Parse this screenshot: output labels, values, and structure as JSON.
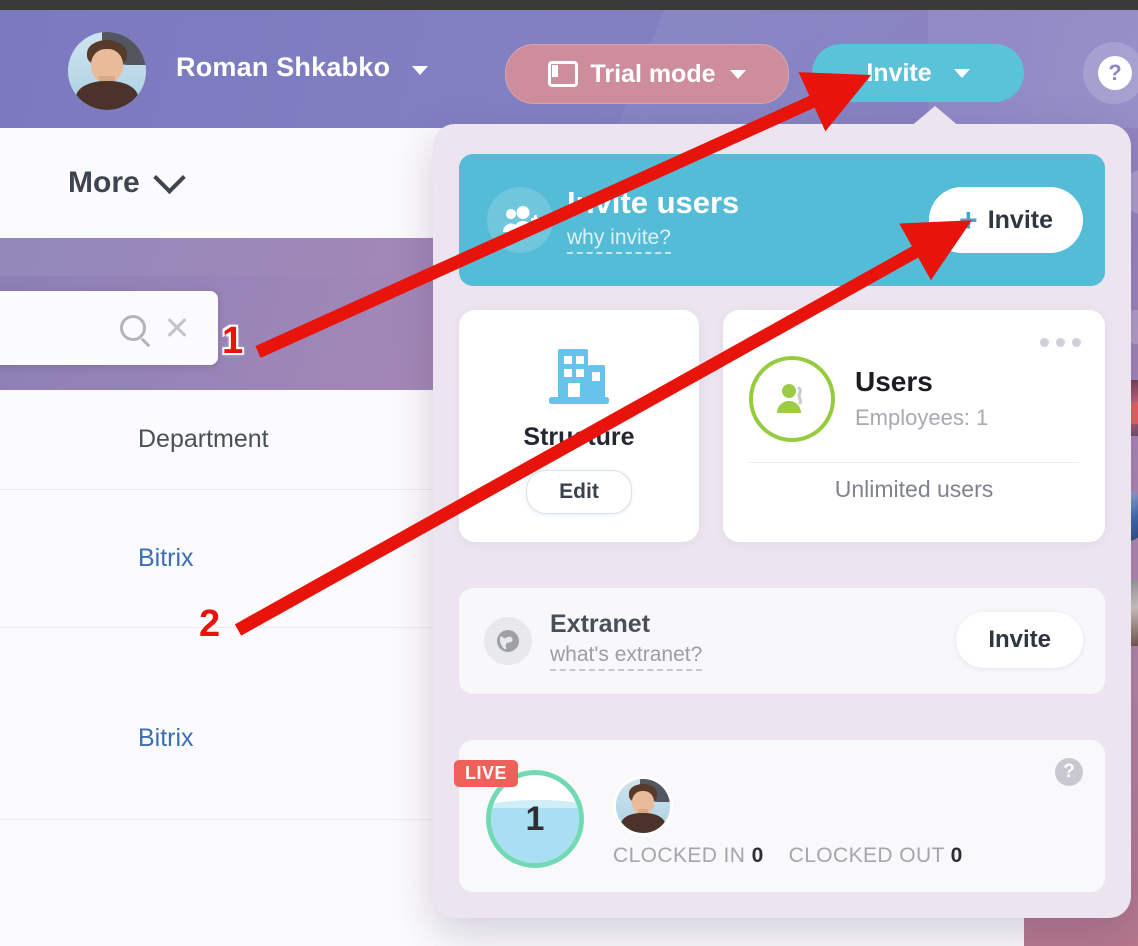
{
  "header": {
    "user_name": "Roman Shkabko",
    "name_caret": "chevron-down-icon",
    "trial_label": "Trial mode",
    "invite_label": "Invite",
    "help_label": "?"
  },
  "background": {
    "more_label": "More",
    "search_placeholder": "",
    "search_value": "",
    "column_header": "Department",
    "rows": [
      {
        "label": "Bitrix"
      },
      {
        "label": "Bitrix"
      }
    ]
  },
  "popup": {
    "banner": {
      "title": "Invite users",
      "link": "why invite?",
      "button_plus": "+",
      "button_label": "Invite"
    },
    "structure_card": {
      "title": "Structure",
      "edit_label": "Edit"
    },
    "users_card": {
      "title": "Users",
      "subtitle": "Employees: 1",
      "footer": "Unlimited users",
      "menu_icon": "ellipsis-icon"
    },
    "extranet": {
      "title": "Extranet",
      "link": "what's extranet?",
      "button_label": "Invite"
    },
    "live": {
      "badge": "LIVE",
      "count": "1",
      "clocked_in_label": "CLOCKED IN",
      "clocked_in_value": "0",
      "clocked_out_label": "CLOCKED OUT",
      "clocked_out_value": "0",
      "help_label": "?"
    }
  },
  "annotations": {
    "marker_one": "1",
    "marker_two": "2"
  },
  "colors": {
    "header_purple": "#7b79bf",
    "trial_pink": "#cd8d9d",
    "accent_teal": "#54bcd6",
    "popup_bg": "#ece5f0",
    "green_ring": "#97cb3e",
    "live_green": "#73d9b3",
    "live_red": "#f0605a",
    "link_blue": "#3c6eb4",
    "annotation_red": "#e8140c"
  }
}
